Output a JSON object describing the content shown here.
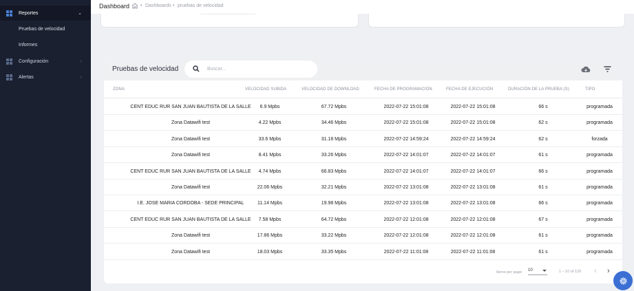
{
  "sidebar": {
    "reportes": {
      "label": "Reportes",
      "icon": "dashboard-grid-icon"
    },
    "pruebas": {
      "label": "Pruebas de velocidad"
    },
    "informes": {
      "label": "Informes"
    },
    "configuracion": {
      "label": "Configuración",
      "icon": "dashboard-grid-icon"
    },
    "alertas": {
      "label": "Alertas",
      "icon": "dashboard-grid-icon"
    }
  },
  "header": {
    "title": "Dashboard",
    "breadcrumb": [
      "Dashboards",
      "pruebas de velocidad"
    ]
  },
  "card": {
    "title": "Pruebas de velocidad",
    "search_placeholder": "Buscar..."
  },
  "table": {
    "columns": [
      "ZONA",
      "VELOCIDAD SUBIDA",
      "VELOCIDAD DE DOWNLOAD",
      "FECHA DE PROGRAMACIÓN",
      "FECHA DE EJECUCIÓN",
      "DURACIÓN DE LA PRUEBA (S)",
      "TIPO"
    ],
    "rows": [
      [
        "CENT EDUC RUR SAN JUAN BAUTISTA DE LA SALLE",
        "6.9 Mpbs",
        "67.72 Mpbs",
        "2022-07-22 15:01:08",
        "2022-07-22 15:01:08",
        "66 s",
        "programada"
      ],
      [
        "Zona Datawifi test",
        "4.22 Mpbs",
        "34.46 Mpbs",
        "2022-07-22 15:01:08",
        "2022-07-22 15:01:08",
        "62 s",
        "programada"
      ],
      [
        "Zona Datawifi test",
        "33.6 Mpbs",
        "31.18 Mpbs",
        "2022-07-22 14:59:24",
        "2022-07-22 14:59:24",
        "62 s",
        "forzada"
      ],
      [
        "Zona Datawifi test",
        "8.41 Mpbs",
        "33.26 Mpbs",
        "2022-07-22 14:01:07",
        "2022-07-22 14:01:07",
        "61 s",
        "programada"
      ],
      [
        "CENT EDUC RUR SAN JUAN BAUTISTA DE LA SALLE",
        "4.74 Mpbs",
        "66.83 Mpbs",
        "2022-07-22 14:01:07",
        "2022-07-22 14:01:07",
        "66 s",
        "programada"
      ],
      [
        "Zona Datawifi test",
        "22.06 Mpbs",
        "32.21 Mpbs",
        "2022-07-22 13:01:08",
        "2022-07-22 13:01:08",
        "61 s",
        "programada"
      ],
      [
        "I.E. JOSE MARIA CORDOBA - SEDE PRINCIPAL",
        "11.14 Mpbs",
        "19.98 Mpbs",
        "2022-07-22 13:01:08",
        "2022-07-22 13:01:08",
        "66 s",
        "programada"
      ],
      [
        "CENT EDUC RUR SAN JUAN BAUTISTA DE LA SALLE",
        "7.58 Mpbs",
        "64.72 Mpbs",
        "2022-07-22 12:01:08",
        "2022-07-22 12:01:08",
        "67 s",
        "programada"
      ],
      [
        "Zona Datawifi test",
        "17.86 Mpbs",
        "33.22 Mpbs",
        "2022-07-22 12:01:08",
        "2022-07-22 12:01:08",
        "61 s",
        "programada"
      ],
      [
        "Zona Datawifi test",
        "18.03 Mpbs",
        "33.35 Mpbs",
        "2022-07-22 11:01:08",
        "2022-07-22 11:01:08",
        "61 s",
        "programada"
      ]
    ]
  },
  "pagination": {
    "items_per_page_label": "Items per page:",
    "items_per_page": "10",
    "range": "1 – 10 of 129"
  },
  "colors": {
    "sidebar_bg": "#1b2031",
    "accent": "#3b6fd4"
  }
}
